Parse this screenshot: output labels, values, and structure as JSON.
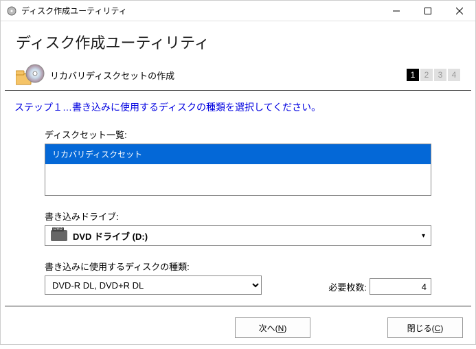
{
  "window": {
    "title": "ディスク作成ユーティリティ"
  },
  "header": {
    "title": "ディスク作成ユーティリティ"
  },
  "section": {
    "label": "リカバリディスクセットの作成",
    "steps": [
      "1",
      "2",
      "3",
      "4"
    ],
    "active_step": 0
  },
  "instruction": "ステップ１…書き込みに使用するディスクの種類を選択してください。",
  "content": {
    "list_label": "ディスクセット一覧:",
    "list_items": [
      "リカバリディスクセット"
    ],
    "list_selected": 0,
    "drive_label": "書き込みドライブ:",
    "drive_value": "DVD ドライブ (D:)",
    "disc_type_label": "書き込みに使用するディスクの種類:",
    "disc_type_value": "DVD-R DL, DVD+R DL",
    "count_label": "必要枚数:",
    "count_value": "4"
  },
  "footer": {
    "next": "次へ",
    "next_key": "N",
    "close": "閉じる",
    "close_key": "C"
  }
}
